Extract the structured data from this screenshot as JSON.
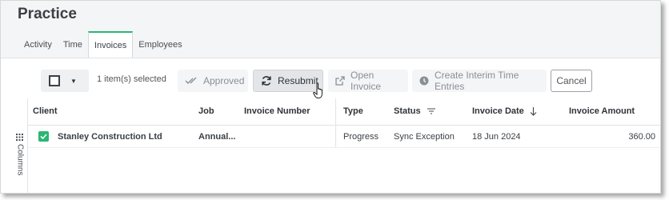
{
  "page": {
    "title": "Practice"
  },
  "tabs": [
    {
      "label": "Activity",
      "active": false
    },
    {
      "label": "Time",
      "active": false
    },
    {
      "label": "Invoices",
      "active": true
    },
    {
      "label": "Employees",
      "active": false
    }
  ],
  "toolbar": {
    "selected_count": "1 item(s) selected",
    "approved_label": "Approved",
    "resubmit_label": "Resubmit",
    "open_invoice_label": "Open Invoice",
    "interim_label": "Create Interim Time Entries",
    "cancel_label": "Cancel"
  },
  "sidebar": {
    "columns_label": "Columns"
  },
  "table": {
    "headers": {
      "client": "Client",
      "job": "Job",
      "invoice_number": "Invoice Number",
      "type": "Type",
      "status": "Status",
      "invoice_date": "Invoice Date",
      "invoice_amount": "Invoice Amount"
    },
    "rows": [
      {
        "selected": true,
        "client": "Stanley Construction Ltd",
        "job": "Annual...",
        "invoice_number": "",
        "type": "Progress",
        "status": "Sync Exception",
        "invoice_date": "18 Jun 2024",
        "invoice_amount": "360.00"
      }
    ]
  },
  "colors": {
    "accent_green": "#2bb673",
    "text_dark": "#3b4046",
    "disabled_text": "#8a8f95"
  },
  "icons": {
    "approved": "double-check-icon",
    "resubmit": "refresh-icon",
    "open_invoice": "external-link-icon",
    "interim": "clock-icon",
    "status_filter": "filter-icon",
    "invoice_date_sort": "arrow-down-icon",
    "columns": "grid-icon"
  }
}
